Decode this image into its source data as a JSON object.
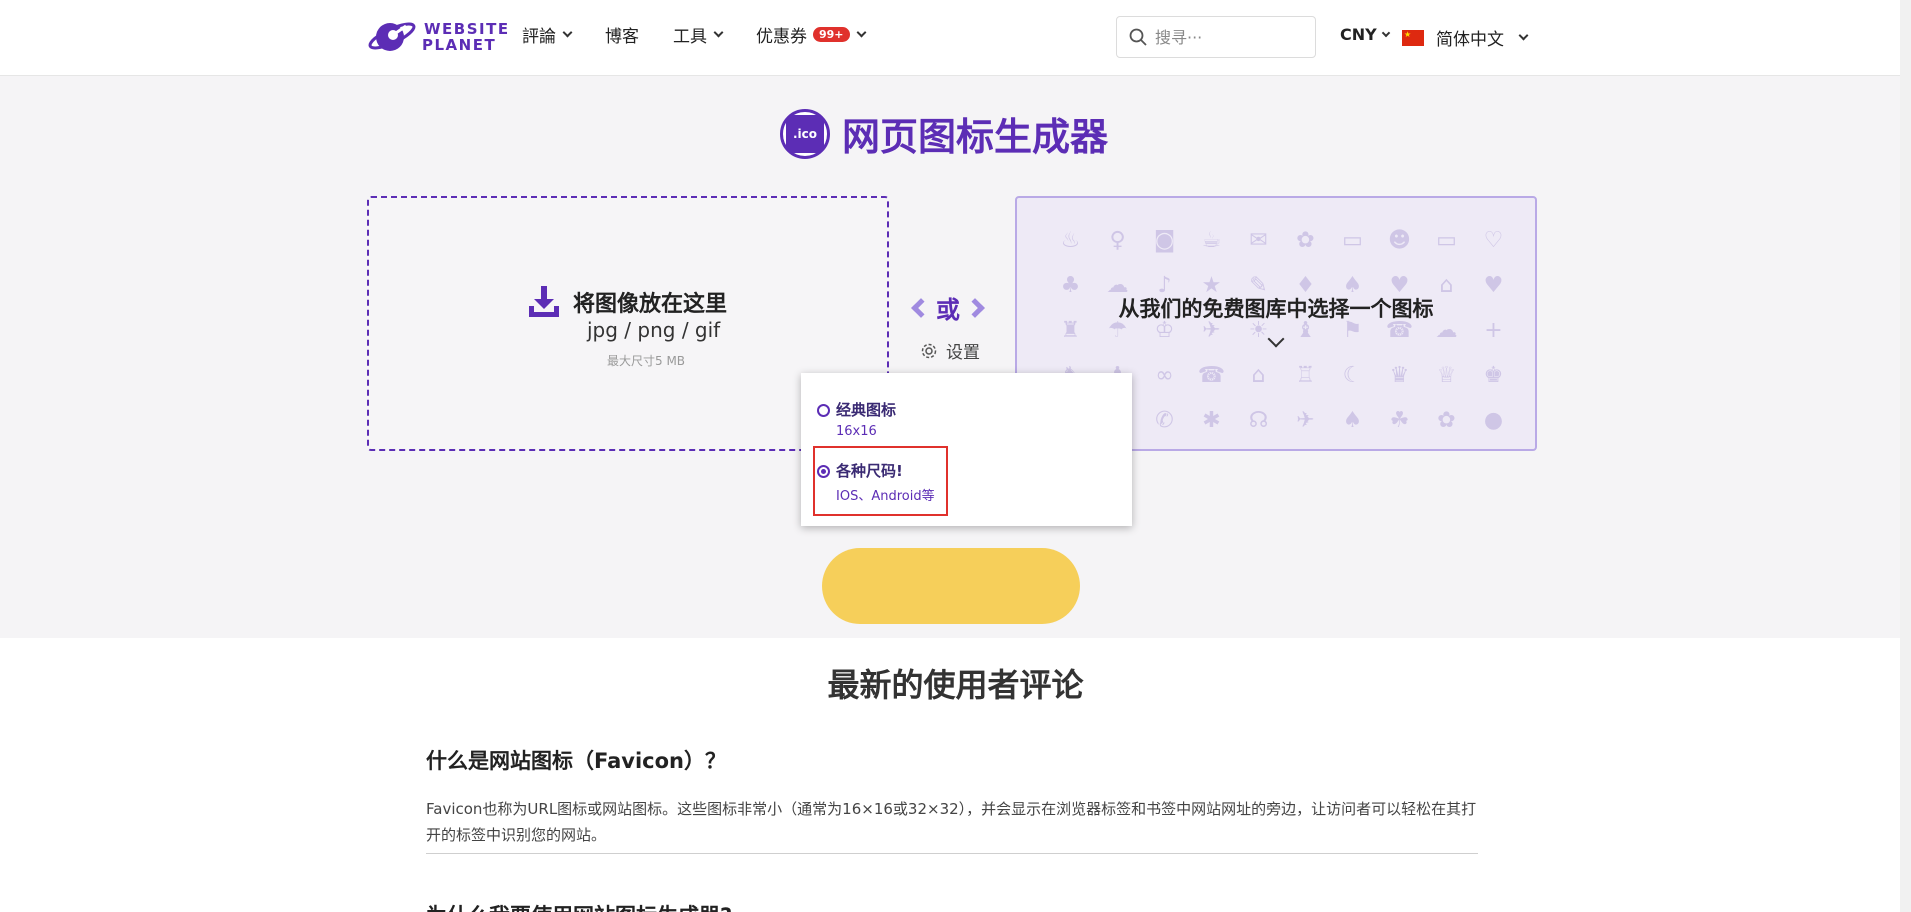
{
  "header": {
    "logo_line1": "WEBSITE",
    "logo_line2": "PLANET",
    "nav": [
      {
        "label": "評論",
        "dropdown": true
      },
      {
        "label": "博客",
        "dropdown": false
      },
      {
        "label": "工具",
        "dropdown": true
      },
      {
        "label": "优惠券",
        "badge": "99+",
        "dropdown": true
      }
    ],
    "search_placeholder": "搜寻···",
    "currency": "CNY",
    "language": "简体中文"
  },
  "hero": {
    "title_icon_text": ".ico",
    "title": "网页图标生成器",
    "dropzone": {
      "title": "将图像放在这里",
      "formats": "jpg / png / gif",
      "max_size": "最大尺寸5 MB"
    },
    "or_label": "或",
    "settings_label": "设置",
    "library_label": "从我们的免费图库中选择一个图标"
  },
  "settings_popup": {
    "options": [
      {
        "title": "经典图标",
        "subtitle": "16x16",
        "selected": false
      },
      {
        "title": "各种尺码!",
        "subtitle": "IOS、Android等",
        "selected": true
      }
    ]
  },
  "content": {
    "reviews_title": "最新的使用者评论",
    "q1": "什么是网站图标（Favicon）？",
    "p1": "Favicon也称为URL图标或网站图标。这些图标非常小（通常为16×16或32×32），并会显示在浏览器标签和书签中网站网址的旁边，让访问者可以轻松在其打开的标签中识别您的网站。",
    "q2": "为什么我要使用网站图标生成器?"
  },
  "colors": {
    "brand": "#5c2db5",
    "accent_yellow": "#f6cf5a",
    "badge_red": "#e0312c"
  }
}
